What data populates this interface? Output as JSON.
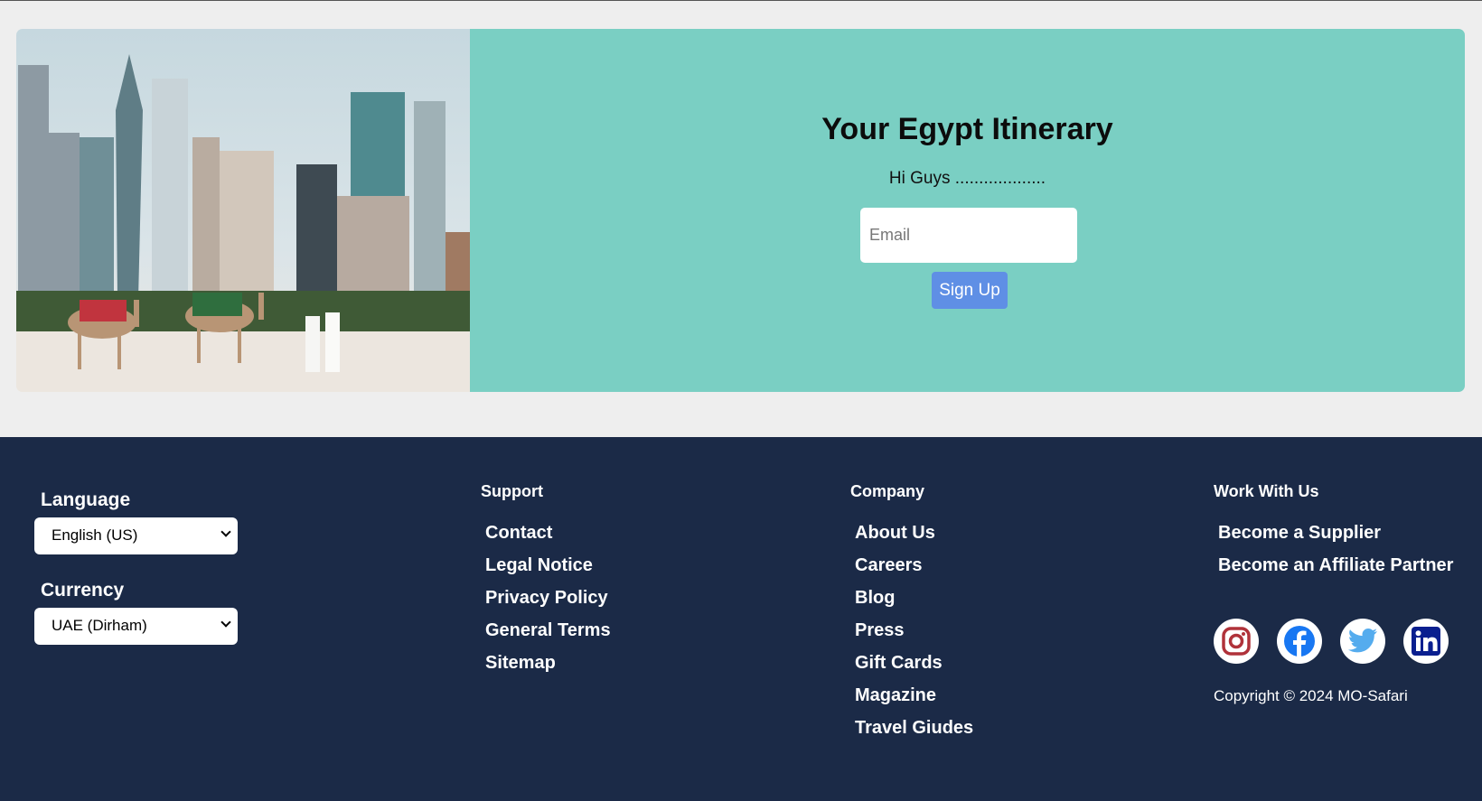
{
  "newsletter": {
    "title": "Your Egypt Itinerary",
    "subtitle": "Hi Guys ...................",
    "email_placeholder": "Email",
    "signup_label": "Sign Up"
  },
  "footer": {
    "language_label": "Language",
    "language_value": "English (US)",
    "currency_label": "Currency",
    "currency_value": "UAE (Dirham)",
    "support": {
      "heading": "Support",
      "links": [
        "Contact",
        "Legal Notice",
        "Privacy Policy",
        "General Terms",
        "Sitemap"
      ]
    },
    "company": {
      "heading": "Company",
      "links": [
        "About Us",
        "Careers",
        "Blog",
        "Press",
        "Gift Cards",
        "Magazine",
        "Travel Giudes"
      ]
    },
    "work": {
      "heading": "Work With Us",
      "links": [
        "Become a Supplier",
        "Become an Affiliate Partner"
      ]
    },
    "social_icons": [
      "instagram-icon",
      "facebook-icon",
      "twitter-icon",
      "linkedin-icon"
    ],
    "copyright": "Copyright © 2024 MO-Safari"
  },
  "colors": {
    "accent_teal": "#7acfc3",
    "button_blue": "#5f8fe5",
    "footer_navy": "#1b2a47",
    "page_bg": "#eeeeee"
  }
}
